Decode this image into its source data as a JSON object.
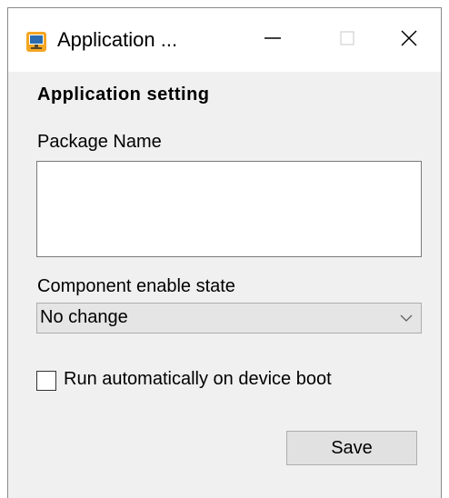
{
  "window": {
    "title": "Application ...",
    "icon": "monitor-app-icon"
  },
  "titlebar_controls": {
    "minimize_icon": "minimize-icon",
    "maximize_icon": "maximize-icon",
    "close_icon": "close-icon"
  },
  "form": {
    "section_title": "Application setting",
    "package_label": "Package Name",
    "package_value": "",
    "component_label": "Component enable state",
    "component_selected": "No change",
    "run_on_boot_label": "Run automatically on device boot",
    "run_on_boot_checked": false,
    "save_label": "Save"
  },
  "colors": {
    "window_bg": "#f0f0f0",
    "titlebar_bg": "#ffffff",
    "icon_accent": "#f5a623",
    "icon_screen": "#2b6cb0"
  }
}
